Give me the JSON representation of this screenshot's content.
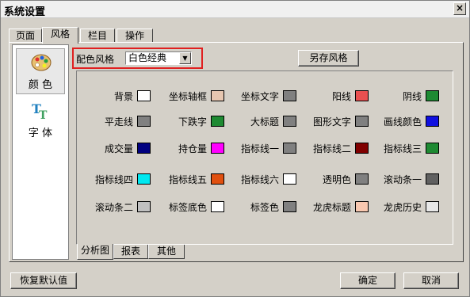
{
  "window": {
    "title": "系统设置",
    "close_glyph": "×"
  },
  "main_tabs": [
    {
      "label": "页面",
      "active": false
    },
    {
      "label": "风格",
      "active": true
    },
    {
      "label": "栏目",
      "active": false
    },
    {
      "label": "操作",
      "active": false
    }
  ],
  "categories": [
    {
      "label": "颜 色",
      "icon": "palette-icon",
      "selected": true
    },
    {
      "label": "字 体",
      "icon": "font-icon",
      "selected": false
    }
  ],
  "scheme": {
    "label": "配色风格",
    "value": "白色经典",
    "arrow": "▼"
  },
  "buttons": {
    "save_style": "另存风格",
    "reset": "恢复默认值",
    "ok": "确定",
    "cancel": "取消"
  },
  "colors": [
    {
      "label": "背景",
      "color": "#ffffff"
    },
    {
      "label": "坐标轴框",
      "color": "#e6c6b0"
    },
    {
      "label": "坐标文字",
      "color": "#808080"
    },
    {
      "label": "阳线",
      "color": "#e85050"
    },
    {
      "label": "阴线",
      "color": "#1e8a32"
    },
    {
      "label": "平走线",
      "color": "#808080"
    },
    {
      "label": "下跌字",
      "color": "#1e8a32"
    },
    {
      "label": "大标题",
      "color": "#808080"
    },
    {
      "label": "图形文字",
      "color": "#808080"
    },
    {
      "label": "画线颜色",
      "color": "#1010e0"
    },
    {
      "label": "成交量",
      "color": "#000080"
    },
    {
      "label": "持仓量",
      "color": "#ff00ff"
    },
    {
      "label": "指标线一",
      "color": "#808080"
    },
    {
      "label": "指标线二",
      "color": "#800000"
    },
    {
      "label": "指标线三",
      "color": "#1e8a32"
    },
    {
      "label": "指标线四",
      "color": "#00e8f0"
    },
    {
      "label": "指标线五",
      "color": "#e05010"
    },
    {
      "label": "指标线六",
      "color": "#ffffff"
    },
    {
      "label": "透明色",
      "color": "#808080"
    },
    {
      "label": "滚动条一",
      "color": "#606060"
    },
    {
      "label": "滚动条二",
      "color": "#c0c0c0"
    },
    {
      "label": "标签底色",
      "color": "#ffffff"
    },
    {
      "label": "标签色",
      "color": "#808080"
    },
    {
      "label": "龙虎标题",
      "color": "#f8c8b0"
    },
    {
      "label": "龙虎历史",
      "color": "#e8e8e8"
    }
  ],
  "sub_tabs": [
    {
      "label": "分析图",
      "active": true
    },
    {
      "label": "报表",
      "active": false
    },
    {
      "label": "其他",
      "active": false
    }
  ]
}
